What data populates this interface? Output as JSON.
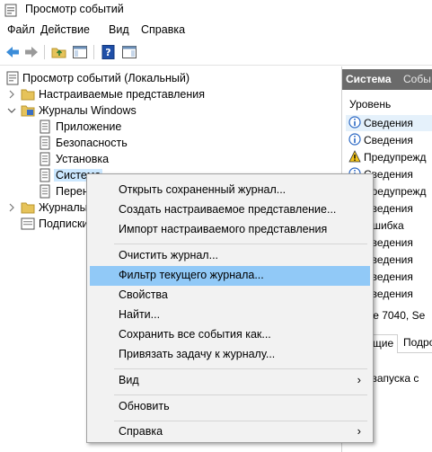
{
  "window": {
    "title": "Просмотр событий"
  },
  "menubar": {
    "items": [
      "Файл",
      "Действие",
      "Вид",
      "Справка"
    ]
  },
  "tree": {
    "root": "Просмотр событий (Локальный)",
    "custom_views": "Настраиваемые представления",
    "windows_logs": "Журналы Windows",
    "logs": [
      "Приложение",
      "Безопасность",
      "Установка",
      "Система",
      "Перен"
    ],
    "app_services": "Журналы",
    "subscriptions": "Подписки"
  },
  "right_pane": {
    "tabs": [
      "Система",
      "Собы"
    ],
    "column_header": "Уровень",
    "rows": [
      {
        "level": "Сведения",
        "icon": "info-icon"
      },
      {
        "level": "Сведения",
        "icon": "info-icon"
      },
      {
        "level": "Предупрежд",
        "icon": "warning-icon"
      },
      {
        "level": "Сведения",
        "icon": "info-icon"
      },
      {
        "level": "Предупрежд",
        "icon": "warning-icon"
      },
      {
        "level": "Сведения",
        "icon": "info-icon"
      },
      {
        "level": "Ошибка",
        "icon": "error-icon"
      },
      {
        "level": "Сведения",
        "icon": "info-icon"
      },
      {
        "level": "Сведения",
        "icon": "info-icon"
      },
      {
        "level": "Сведения",
        "icon": "info-icon"
      },
      {
        "level": "Сведения",
        "icon": "info-icon"
      }
    ],
    "event_title": "тие 7040, Se",
    "detail_tabs": [
      "бщие",
      "Подро"
    ],
    "detail_text": "Тип запуска с"
  },
  "context_menu": {
    "items": [
      "Открыть сохраненный журнал...",
      "Создать настраиваемое представление...",
      "Импорт настраиваемого представления",
      "Очистить журнал...",
      "Фильтр текущего журнала...",
      "Свойства",
      "Найти...",
      "Сохранить все события как...",
      "Привязать задачу к журналу...",
      "Вид",
      "Обновить",
      "Справка"
    ],
    "submenu_arrow": "›"
  },
  "colors": {
    "highlight": "#91c9f7",
    "menu_bg": "#f2f2f2",
    "header_bg": "#6a6a6a",
    "selection": "#cce8ff"
  }
}
